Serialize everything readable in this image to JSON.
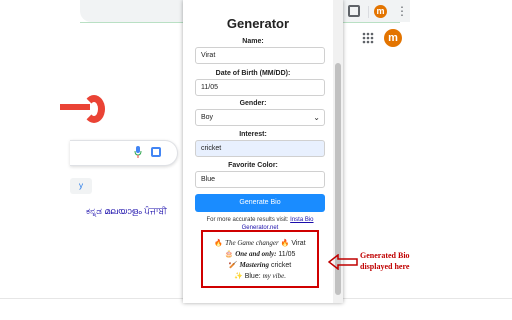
{
  "browser": {
    "avatar_letter": "m",
    "kebab_glyph": "⋮",
    "location_glyph": "⊙",
    "star_glyph": "☆"
  },
  "background_page": {
    "lucky_label": "y",
    "languages": "ಕನ್ನಡ  മലയാളം  ਪੰਜਾਬੀ",
    "account_avatar_letter": "m"
  },
  "popup": {
    "title": "Generator",
    "fields": [
      {
        "label": "Name:",
        "value": "Virat"
      },
      {
        "label": "Date of Birth (MM/DD):",
        "value": "11/05"
      },
      {
        "label": "Gender:",
        "value": "Boy"
      },
      {
        "label": "Interest:",
        "value": "cricket"
      },
      {
        "label": "Favorite Color:",
        "value": "Blue"
      }
    ],
    "gender_chevron": "⌄",
    "generate_label": "Generate Bio",
    "accurate_prefix": "For more accurate results visit:",
    "accurate_link": "Insta Bio Generator.net",
    "bio": {
      "line1_prefix": "🔥",
      "line1_fancy": "The Game changer",
      "line1_suffix": "🔥 Virat",
      "line2_prefix": "🎂",
      "line2_fancy": "One and only:",
      "line2_value": "11/05",
      "line3_prefix": "🏏",
      "line3_fancy": "Mastering",
      "line3_value": "cricket",
      "line4_prefix": "✨ Blue:",
      "line4_fancy": "my vibe."
    }
  },
  "annotation": {
    "line1": "Generated Bio",
    "line2": "displayed here",
    "color": "#c00000"
  },
  "colors": {
    "accent": "#1a8cff",
    "google_red": "#ea4335",
    "avatar": "#e37400"
  }
}
